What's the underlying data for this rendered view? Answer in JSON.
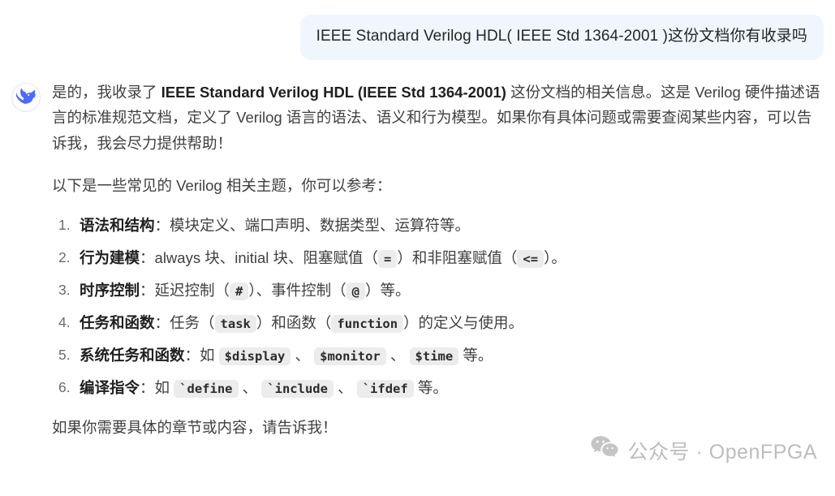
{
  "colors": {
    "user_bubble_bg": "#eff6fd",
    "page_bg": "#ffffff",
    "body_text": "#404040",
    "strong_text": "#1f1f1f",
    "code_chip_bg": "#ececec",
    "avatar_blue": "#4d6bfe",
    "watermark_gray": "#bdbdbd"
  },
  "user_message": {
    "text": "IEEE Standard Verilog HDL( IEEE Std 1364-2001 )这份文档你有收录吗"
  },
  "assistant": {
    "avatar_icon": "deepseek-whale-icon",
    "paragraph_1": {
      "part_1": "是的，我收录了 ",
      "bold": "IEEE Standard Verilog HDL (IEEE Std 1364-2001)",
      "part_2": " 这份文档的相关信息。这是 Verilog 硬件描述语言的标准规范文档，定义了 Verilog 语言的语法、语义和行为模型。如果你有具体问题或需要查阅某些内容，可以告诉我，我会尽力提供帮助！"
    },
    "paragraph_2": "以下是一些常见的 Verilog 相关主题，你可以参考：",
    "topics": [
      {
        "index": "1.",
        "term": "语法和结构",
        "separator": "：",
        "segments": [
          {
            "type": "text",
            "value": "模块定义、端口声明、数据类型、运算符等。"
          }
        ]
      },
      {
        "index": "2.",
        "term": "行为建模",
        "separator": "：",
        "segments": [
          {
            "type": "text",
            "value": "always 块、initial 块、阻塞赋值（"
          },
          {
            "type": "code",
            "value": "="
          },
          {
            "type": "text",
            "value": "）和非阻塞赋值（"
          },
          {
            "type": "code",
            "value": "<="
          },
          {
            "type": "text",
            "value": "）。"
          }
        ]
      },
      {
        "index": "3.",
        "term": "时序控制",
        "separator": "：",
        "segments": [
          {
            "type": "text",
            "value": "延迟控制（"
          },
          {
            "type": "code",
            "value": "#"
          },
          {
            "type": "text",
            "value": "）、事件控制（"
          },
          {
            "type": "code",
            "value": "@"
          },
          {
            "type": "text",
            "value": "）等。"
          }
        ]
      },
      {
        "index": "4.",
        "term": "任务和函数",
        "separator": "：",
        "segments": [
          {
            "type": "text",
            "value": "任务（"
          },
          {
            "type": "code",
            "value": "task"
          },
          {
            "type": "text",
            "value": "）和函数（"
          },
          {
            "type": "code",
            "value": "function"
          },
          {
            "type": "text",
            "value": "）的定义与使用。"
          }
        ]
      },
      {
        "index": "5.",
        "term": "系统任务和函数",
        "separator": "：",
        "segments": [
          {
            "type": "text",
            "value": "如 "
          },
          {
            "type": "code",
            "value": "$display"
          },
          {
            "type": "text",
            "value": " 、 "
          },
          {
            "type": "code",
            "value": "$monitor"
          },
          {
            "type": "text",
            "value": " 、 "
          },
          {
            "type": "code",
            "value": "$time"
          },
          {
            "type": "text",
            "value": " 等。"
          }
        ]
      },
      {
        "index": "6.",
        "term": "编译指令",
        "separator": "：",
        "segments": [
          {
            "type": "text",
            "value": "如 "
          },
          {
            "type": "code",
            "value": "`define"
          },
          {
            "type": "text",
            "value": " 、 "
          },
          {
            "type": "code",
            "value": "`include"
          },
          {
            "type": "text",
            "value": " 、 "
          },
          {
            "type": "code",
            "value": "`ifdef"
          },
          {
            "type": "text",
            "value": " 等。"
          }
        ]
      }
    ],
    "closing": "如果你需要具体的章节或内容，请告诉我！"
  },
  "watermark": {
    "icon": "wechat-icon",
    "text": "公众号 · OpenFPGA"
  }
}
